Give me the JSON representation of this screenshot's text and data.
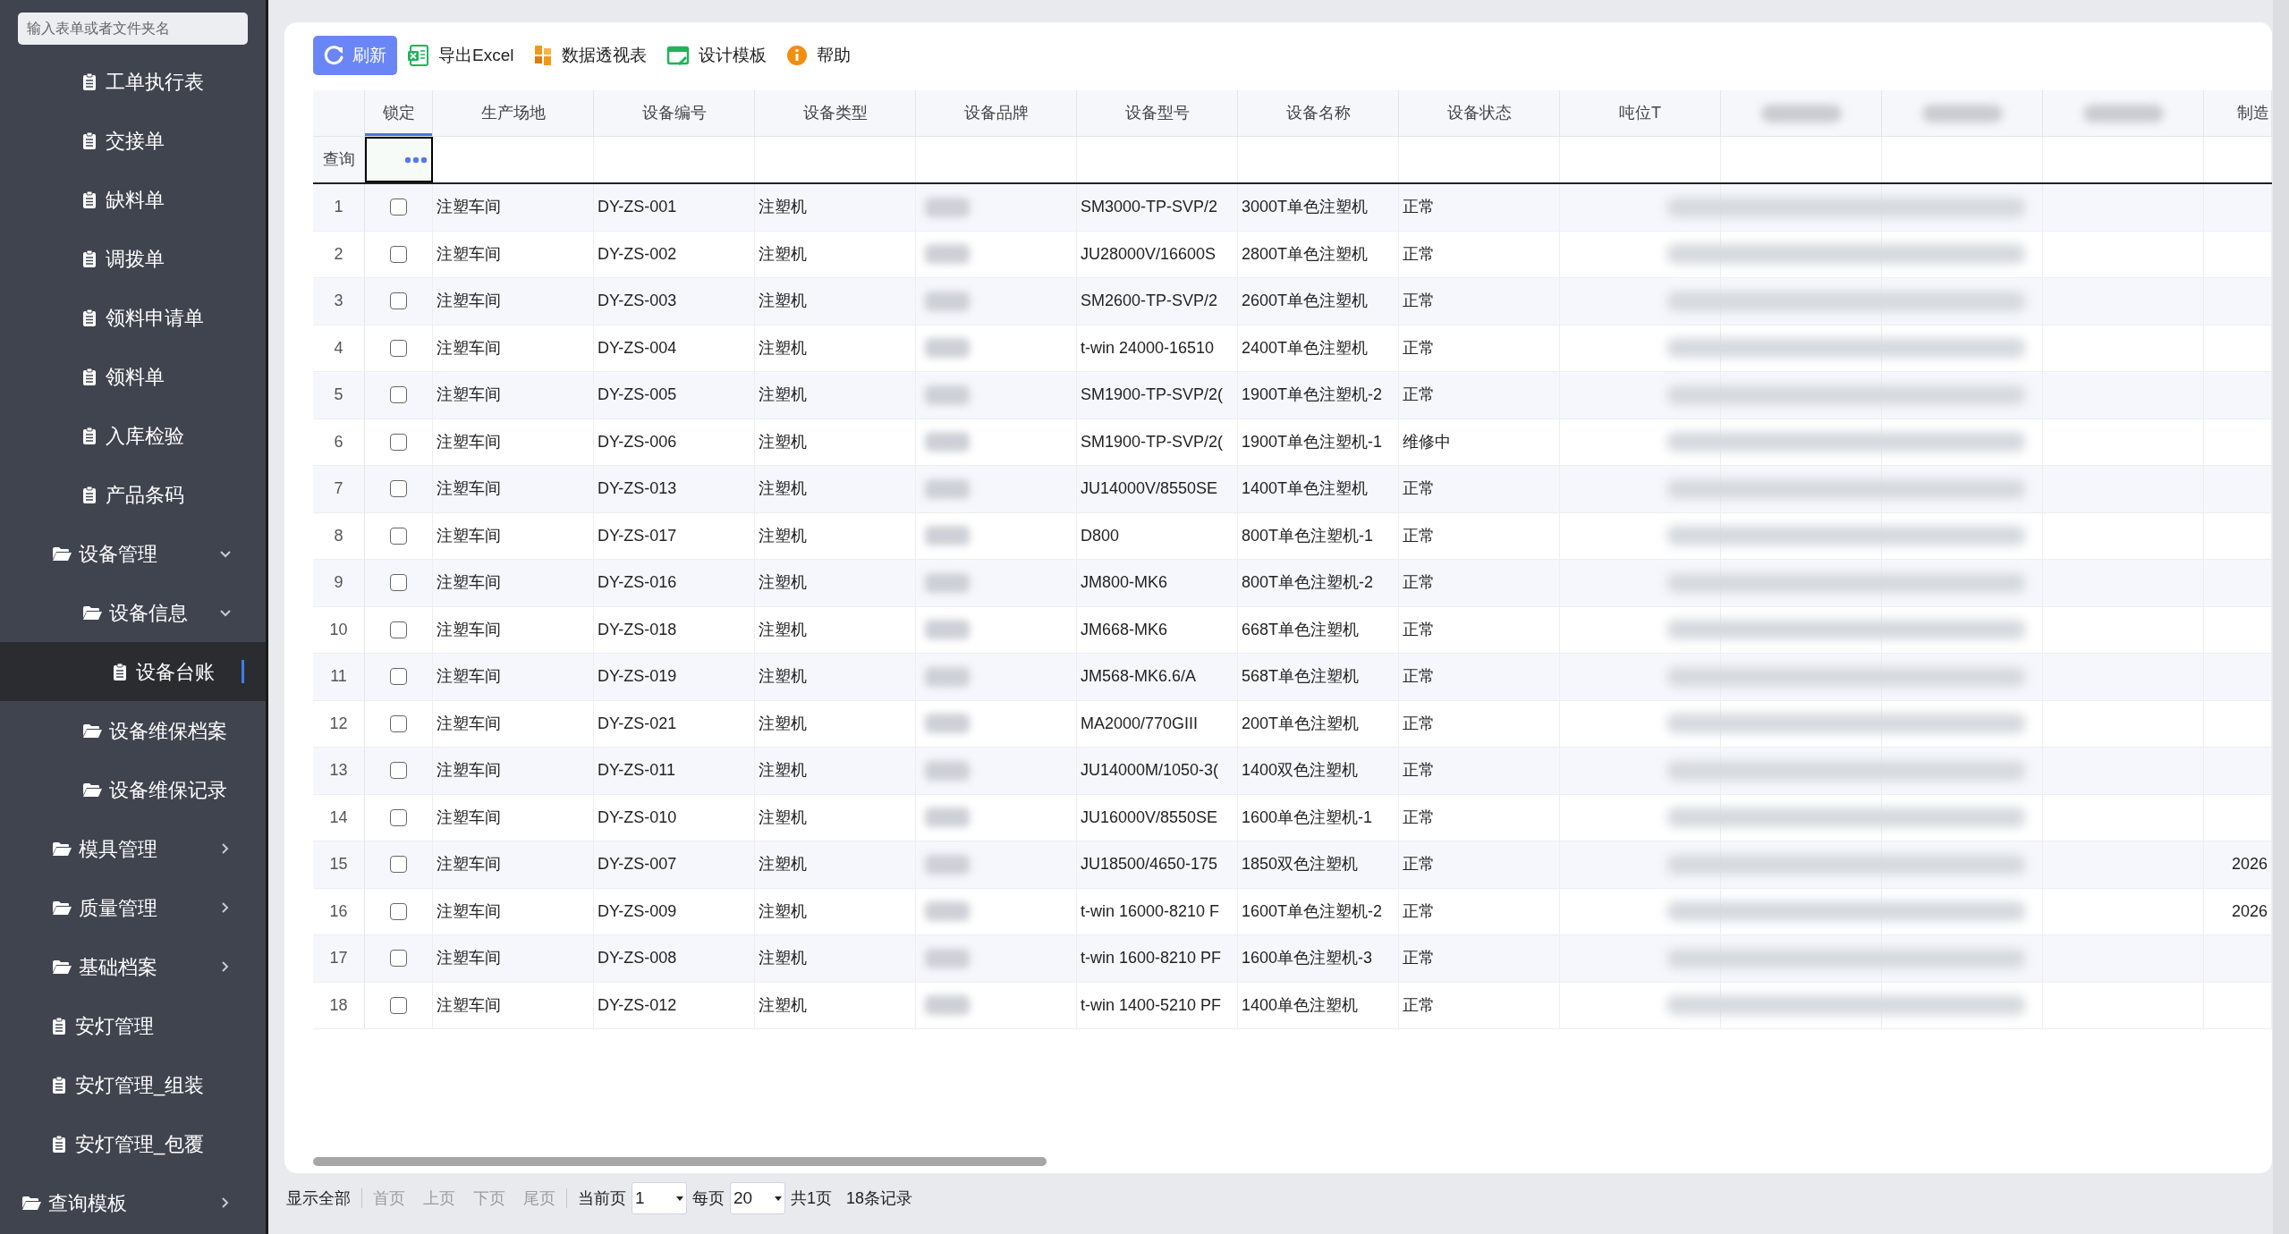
{
  "sidebar": {
    "search": {
      "placeholder": "输入表单或者文件夹名"
    },
    "tree": [
      {
        "children": [
          {
            "children": [
              {
                "label": "工单执行表",
                "kind": "doc",
                "selected": false
              },
              {
                "label": "交接单",
                "kind": "doc",
                "selected": false
              },
              {
                "label": "缺料单",
                "kind": "doc",
                "selected": false
              },
              {
                "label": "调拨单",
                "kind": "doc",
                "selected": false
              },
              {
                "label": "领料申请单",
                "kind": "doc",
                "selected": false
              },
              {
                "label": "领料单",
                "kind": "doc",
                "selected": false
              },
              {
                "label": "入库检验",
                "kind": "doc",
                "selected": false
              },
              {
                "label": "产品条码",
                "kind": "doc",
                "selected": false
              }
            ]
          },
          {
            "label": "设备管理",
            "kind": "folder",
            "expanded": true,
            "selected": false,
            "children": [
              {
                "label": "设备信息",
                "kind": "folder",
                "expanded": true,
                "selected": false,
                "children": [
                  {
                    "label": "设备台账",
                    "kind": "doc",
                    "selected": true
                  }
                ]
              },
              {
                "label": "设备维保档案",
                "kind": "folder",
                "selected": false
              },
              {
                "label": "设备维保记录",
                "kind": "folder",
                "selected": false
              }
            ]
          },
          {
            "label": "模具管理",
            "kind": "folder",
            "expanded": false,
            "selected": false
          },
          {
            "label": "质量管理",
            "kind": "folder",
            "expanded": false,
            "selected": false
          },
          {
            "label": "基础档案",
            "kind": "folder",
            "expanded": false,
            "selected": false
          },
          {
            "label": "安灯管理",
            "kind": "doc",
            "selected": false
          },
          {
            "label": "安灯管理_组装",
            "kind": "doc",
            "selected": false
          },
          {
            "label": "安灯管理_包覆",
            "kind": "doc",
            "selected": false
          }
        ]
      },
      {
        "label": "查询模板",
        "kind": "folder",
        "expanded": false,
        "selected": false
      }
    ]
  },
  "toolbar": [
    {
      "label": "刷新",
      "kind": "refresh"
    },
    {
      "label": "导出Excel",
      "kind": "excel"
    },
    {
      "label": "数据透视表",
      "kind": "pivot"
    },
    {
      "label": "设计模板",
      "kind": "design"
    },
    {
      "label": "帮助",
      "kind": "help"
    }
  ],
  "table": {
    "columns": [
      {
        "label": "锁定",
        "kind": "text",
        "selected": true
      },
      {
        "label": "生产场地",
        "kind": "text",
        "selected": false
      },
      {
        "label": "设备编号",
        "kind": "text",
        "selected": false
      },
      {
        "label": "设备类型",
        "kind": "text",
        "selected": false
      },
      {
        "label": "设备品牌",
        "kind": "text",
        "selected": false
      },
      {
        "label": "设备型号",
        "kind": "text",
        "selected": false
      },
      {
        "label": "设备名称",
        "kind": "text",
        "selected": false
      },
      {
        "label": "设备状态",
        "kind": "text",
        "selected": false
      },
      {
        "label": "吨位T",
        "kind": "text",
        "selected": false
      },
      {
        "kind": "blurred",
        "selected": false
      },
      {
        "kind": "blurred",
        "selected": false
      },
      {
        "kind": "blurred",
        "selected": false
      },
      {
        "label": "制造",
        "kind": "text",
        "selected": false
      }
    ],
    "query_label": "查询",
    "rows": [
      {
        "no": "1",
        "checked": false,
        "site": "注塑车间",
        "code": "DY-ZS-001",
        "type": "注塑机",
        "model": "SM3000-TP-SVP/2",
        "name": "3000T单色注塑机",
        "status": "正常"
      },
      {
        "no": "2",
        "checked": false,
        "site": "注塑车间",
        "code": "DY-ZS-002",
        "type": "注塑机",
        "model": "JU28000V/16600S",
        "name": "2800T单色注塑机",
        "status": "正常"
      },
      {
        "no": "3",
        "checked": false,
        "site": "注塑车间",
        "code": "DY-ZS-003",
        "type": "注塑机",
        "model": "SM2600-TP-SVP/2",
        "name": "2600T单色注塑机",
        "status": "正常"
      },
      {
        "no": "4",
        "checked": false,
        "site": "注塑车间",
        "code": "DY-ZS-004",
        "type": "注塑机",
        "model": "t-win 24000-16510",
        "name": "2400T单色注塑机",
        "status": "正常"
      },
      {
        "no": "5",
        "checked": false,
        "site": "注塑车间",
        "code": "DY-ZS-005",
        "type": "注塑机",
        "model": "SM1900-TP-SVP/2(",
        "name": "1900T单色注塑机-2",
        "status": "正常"
      },
      {
        "no": "6",
        "checked": false,
        "site": "注塑车间",
        "code": "DY-ZS-006",
        "type": "注塑机",
        "model": "SM1900-TP-SVP/2(",
        "name": "1900T单色注塑机-1",
        "status": "维修中"
      },
      {
        "no": "7",
        "checked": false,
        "site": "注塑车间",
        "code": "DY-ZS-013",
        "type": "注塑机",
        "model": "JU14000V/8550SE",
        "name": "1400T单色注塑机",
        "status": "正常"
      },
      {
        "no": "8",
        "checked": false,
        "site": "注塑车间",
        "code": "DY-ZS-017",
        "type": "注塑机",
        "model": "D800",
        "name": "800T单色注塑机-1",
        "status": "正常"
      },
      {
        "no": "9",
        "checked": false,
        "site": "注塑车间",
        "code": "DY-ZS-016",
        "type": "注塑机",
        "model": "JM800-MK6",
        "name": "800T单色注塑机-2",
        "status": "正常"
      },
      {
        "no": "10",
        "checked": false,
        "site": "注塑车间",
        "code": "DY-ZS-018",
        "type": "注塑机",
        "model": "JM668-MK6",
        "name": "668T单色注塑机",
        "status": "正常"
      },
      {
        "no": "11",
        "checked": false,
        "site": "注塑车间",
        "code": "DY-ZS-019",
        "type": "注塑机",
        "model": "JM568-MK6.6/A",
        "name": "568T单色注塑机",
        "status": "正常"
      },
      {
        "no": "12",
        "checked": false,
        "site": "注塑车间",
        "code": "DY-ZS-021",
        "type": "注塑机",
        "model": "MA2000/770GIII",
        "name": "200T单色注塑机",
        "status": "正常"
      },
      {
        "no": "13",
        "checked": false,
        "site": "注塑车间",
        "code": "DY-ZS-011",
        "type": "注塑机",
        "model": "JU14000M/1050-3(",
        "name": "1400双色注塑机",
        "status": "正常"
      },
      {
        "no": "14",
        "checked": false,
        "site": "注塑车间",
        "code": "DY-ZS-010",
        "type": "注塑机",
        "model": "JU16000V/8550SE",
        "name": "1600单色注塑机-1",
        "status": "正常"
      },
      {
        "no": "15",
        "checked": false,
        "site": "注塑车间",
        "code": "DY-ZS-007",
        "type": "注塑机",
        "model": "JU18500/4650-175",
        "name": "1850双色注塑机",
        "status": "正常",
        "column_14": "2026"
      },
      {
        "no": "16",
        "checked": false,
        "site": "注塑车间",
        "code": "DY-ZS-009",
        "type": "注塑机",
        "model": "t-win 16000-8210 F",
        "name": "1600T单色注塑机-2",
        "status": "正常",
        "column_14": "2026"
      },
      {
        "no": "17",
        "checked": false,
        "site": "注塑车间",
        "code": "DY-ZS-008",
        "type": "注塑机",
        "model": "t-win 1600-8210 PF",
        "name": "1600单色注塑机-3",
        "status": "正常"
      },
      {
        "no": "18",
        "checked": false,
        "site": "注塑车间",
        "code": "DY-ZS-012",
        "type": "注塑机",
        "model": "t-win 1400-5210 PF",
        "name": "1400单色注塑机",
        "status": "正常"
      }
    ]
  },
  "pagination": {
    "show_all": "显示全部",
    "nav": [
      {
        "label": "首页",
        "disabled": true
      },
      {
        "label": "上页",
        "disabled": true
      },
      {
        "label": "下页",
        "disabled": true
      },
      {
        "label": "尾页",
        "disabled": true
      }
    ],
    "current_page_label": "当前页",
    "current_page": "1",
    "per_page_label": "每页",
    "per_page": "20",
    "total_pages": "共1页",
    "total_records": "18条记录"
  }
}
